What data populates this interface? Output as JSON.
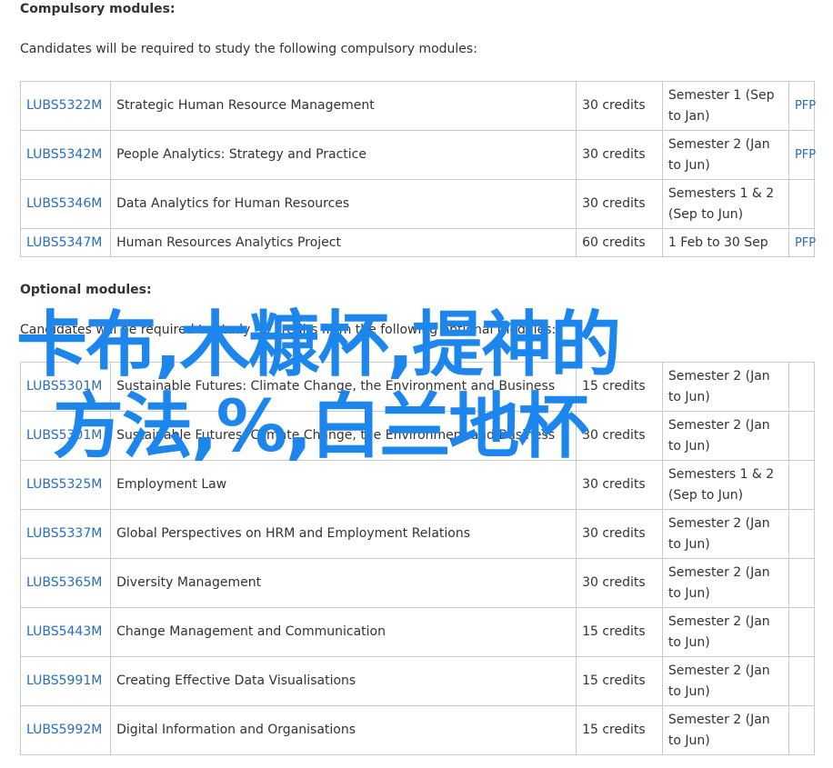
{
  "compulsory": {
    "heading": "Compulsory modules:",
    "intro": "Candidates will be required to study the following compulsory modules:",
    "rows": [
      {
        "code": "LUBS5322M",
        "title": "Strategic Human Resource Management",
        "credits": "30 credits",
        "semester_line1": "Semester 1 (Sep",
        "semester_line2": "to Jan)",
        "pfp": "PFP"
      },
      {
        "code": "LUBS5342M",
        "title": "People Analytics: Strategy and Practice",
        "credits": "30 credits",
        "semester_line1": "Semester 2 (Jan",
        "semester_line2": "to Jun)",
        "pfp": "PFP"
      },
      {
        "code": "LUBS5346M",
        "title": "Data Analytics for Human Resources",
        "credits": "30 credits",
        "semester_line1": "Semesters 1 & 2",
        "semester_line2": "(Sep to Jun)",
        "pfp": ""
      },
      {
        "code": "LUBS5347M",
        "title": "Human Resources Analytics Project",
        "credits": "60 credits",
        "semester_line1": "1 Feb to 30 Sep",
        "semester_line2": "",
        "pfp": "PFP"
      }
    ]
  },
  "optional": {
    "heading": "Optional modules:",
    "intro": "Candidates will be required to study 30 credits from the following optional modules:",
    "rows": [
      {
        "code": "LUBS5301M",
        "title": "Sustainable Futures: Climate Change, the Environment and Business",
        "credits": "15 credits",
        "semester_line1": "Semester 2 (Jan",
        "semester_line2": "to Jun)"
      },
      {
        "code": "LUBS5301M",
        "title": "Sustainable Futures: Climate Change, the Environment and Business",
        "credits": "30 credits",
        "semester_line1": "Semester 2 (Jan",
        "semester_line2": "to Jun)"
      },
      {
        "code": "LUBS5325M",
        "title": "Employment Law",
        "credits": "30 credits",
        "semester_line1": "Semesters 1 & 2",
        "semester_line2": "(Sep to Jun)"
      },
      {
        "code": "LUBS5337M",
        "title": "Global Perspectives on HRM and Employment Relations",
        "credits": "30 credits",
        "semester_line1": "Semester 2 (Jan",
        "semester_line2": "to Jun)"
      },
      {
        "code": "LUBS5365M",
        "title": "Diversity Management",
        "credits": "30 credits",
        "semester_line1": "Semester 2 (Jan",
        "semester_line2": "to Jun)"
      },
      {
        "code": "LUBS5443M",
        "title": "Change Management and Communication",
        "credits": "15 credits",
        "semester_line1": "Semester 2 (Jan",
        "semester_line2": "to Jun)"
      },
      {
        "code": "LUBS5991M",
        "title": "Creating Effective Data Visualisations",
        "credits": "15 credits",
        "semester_line1": "Semester 2 (Jan",
        "semester_line2": "to Jun)"
      },
      {
        "code": "LUBS5992M",
        "title": "Digital Information and Organisations",
        "credits": "15 credits",
        "semester_line1": "Semester 2 (Jan",
        "semester_line2": "to Jun)"
      }
    ]
  },
  "overlay": {
    "line1": "卡布,木糠杯,提神的",
    "line2": "方法,%,白兰地杯",
    "color": "#1d86ec"
  },
  "colors": {
    "link": "#2a6ebb",
    "border": "#c9c9c9",
    "text": "#333333"
  }
}
